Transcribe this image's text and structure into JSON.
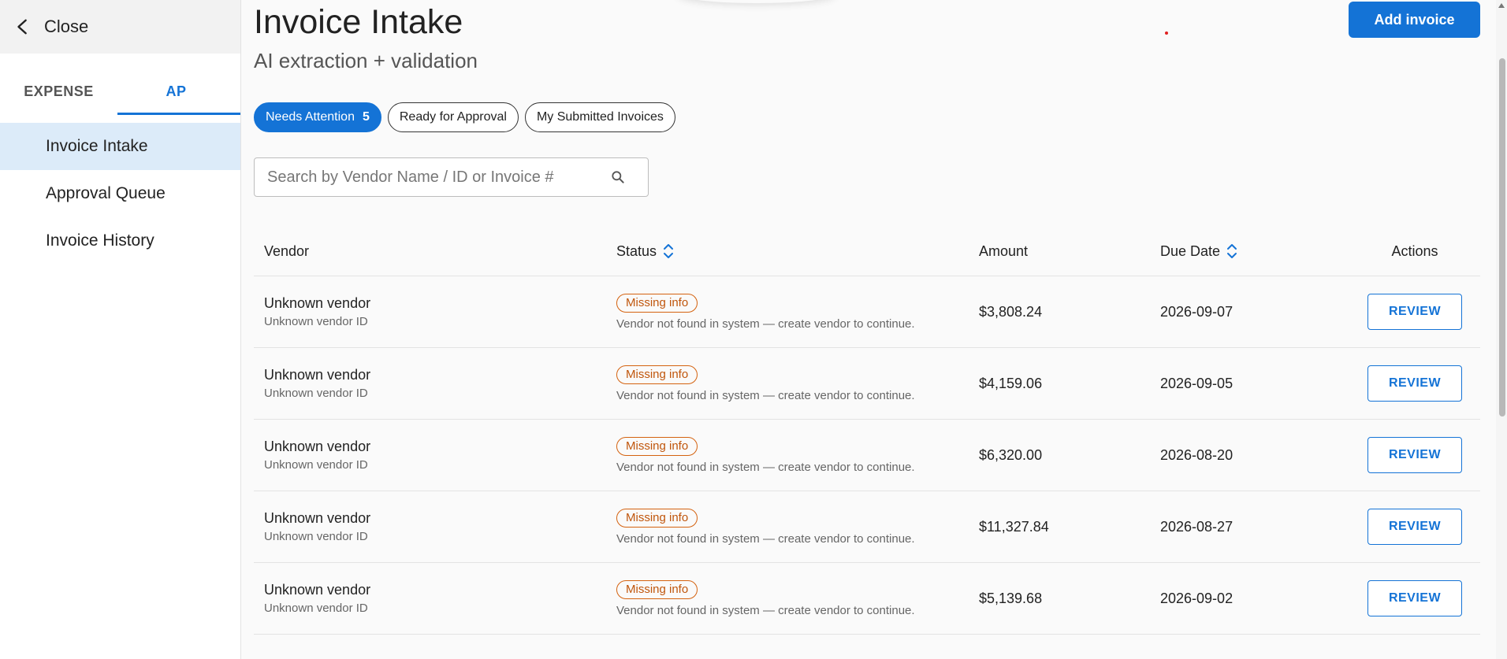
{
  "sidebar": {
    "close_label": "Close",
    "tabs": [
      {
        "label": "EXPENSE",
        "active": false
      },
      {
        "label": "AP",
        "active": true
      }
    ],
    "items": [
      {
        "label": "Invoice Intake",
        "active": true
      },
      {
        "label": "Approval Queue",
        "active": false
      },
      {
        "label": "Invoice History",
        "active": false
      }
    ]
  },
  "header": {
    "title": "Invoice Intake",
    "subtitle": "AI extraction + validation",
    "add_button": "Add invoice"
  },
  "filters": [
    {
      "label": "Needs Attention",
      "count": "5",
      "active": true
    },
    {
      "label": "Ready for Approval",
      "active": false
    },
    {
      "label": "My Submitted Invoices",
      "active": false
    }
  ],
  "search": {
    "placeholder": "Search by Vendor Name / ID or Invoice #",
    "value": ""
  },
  "table": {
    "columns": [
      "Vendor",
      "Status",
      "Amount",
      "Due Date",
      "Actions"
    ],
    "rows": [
      {
        "vendor": "Unknown vendor",
        "vendor_id": "Unknown vendor ID",
        "status": "Missing info",
        "note": "Vendor not found in system — create vendor to continue.",
        "amount": "$3,808.24",
        "due": "2026-09-07",
        "action": "REVIEW"
      },
      {
        "vendor": "Unknown vendor",
        "vendor_id": "Unknown vendor ID",
        "status": "Missing info",
        "note": "Vendor not found in system — create vendor to continue.",
        "amount": "$4,159.06",
        "due": "2026-09-05",
        "action": "REVIEW"
      },
      {
        "vendor": "Unknown vendor",
        "vendor_id": "Unknown vendor ID",
        "status": "Missing info",
        "note": "Vendor not found in system — create vendor to continue.",
        "amount": "$6,320.00",
        "due": "2026-08-20",
        "action": "REVIEW"
      },
      {
        "vendor": "Unknown vendor",
        "vendor_id": "Unknown vendor ID",
        "status": "Missing info",
        "note": "Vendor not found in system — create vendor to continue.",
        "amount": "$11,327.84",
        "due": "2026-08-27",
        "action": "REVIEW"
      },
      {
        "vendor": "Unknown vendor",
        "vendor_id": "Unknown vendor ID",
        "status": "Missing info",
        "note": "Vendor not found in system — create vendor to continue.",
        "amount": "$5,139.68",
        "due": "2026-09-02",
        "action": "REVIEW"
      }
    ]
  },
  "icons": {
    "close": "chevron-left-icon",
    "search": "search-icon",
    "sort": "sort-icon"
  },
  "colors": {
    "accent": "#1473d6",
    "warning": "#d4620f",
    "nav_active_bg": "#dcebf9"
  }
}
